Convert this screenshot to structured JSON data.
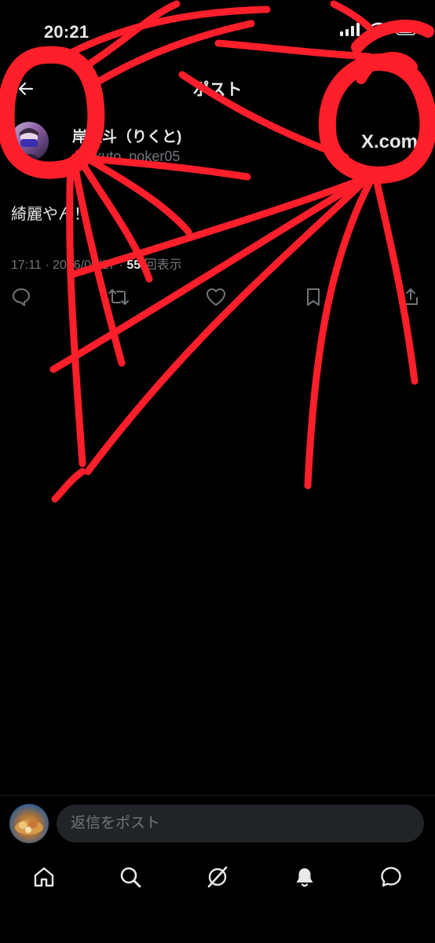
{
  "status_bar": {
    "time": "20:21"
  },
  "header": {
    "title": "ポスト"
  },
  "post": {
    "author_name": "岸陸斗（りくと)",
    "author_handle": "@rikuto_poker05",
    "source_label": "X.com",
    "text": "綺麗やん！",
    "meta_prefix": "17:11 · 2026/09/27 · ",
    "views_count": "55",
    "views_suffix": " 回表示"
  },
  "composer": {
    "placeholder": "返信をポスト"
  },
  "colors": {
    "background": "#000000",
    "text_primary": "#e7e9ea",
    "text_secondary": "#71767b",
    "input_background": "#202327",
    "scribble_red": "#ff1f2b"
  },
  "icons": {
    "back": "arrow-left-icon",
    "reply": "speech-bubble-icon",
    "repost": "repost-icon",
    "like": "heart-icon",
    "bookmark": "bookmark-icon",
    "share": "share-icon",
    "home": "home-icon",
    "search": "search-icon",
    "grok": "grok-icon",
    "notifications": "bell-icon",
    "messages": "message-bubble-icon"
  }
}
